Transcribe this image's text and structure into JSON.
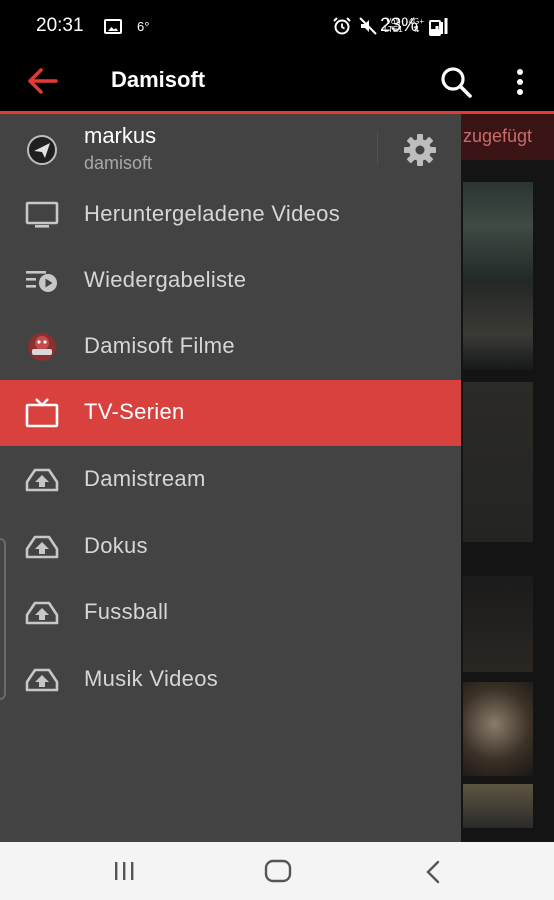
{
  "status_bar": {
    "time": "20:31",
    "temperature": "6°",
    "network_top": "Vo))",
    "network_bottom": "LTE1",
    "network_4g": "4G+",
    "battery": "23%"
  },
  "app_bar": {
    "title": "Damisoft",
    "accent_color": "#e53935"
  },
  "background": {
    "chip_text": "zugefügt"
  },
  "drawer": {
    "account": {
      "name": "markus",
      "subtitle": "damisoft",
      "icon": "send-badge-icon"
    },
    "items": [
      {
        "label": "Heruntergeladene Videos",
        "icon": "downloads-tv-icon",
        "active": false
      },
      {
        "label": "Wiedergabeliste",
        "icon": "playlist-icon",
        "active": false
      },
      {
        "label": "Damisoft Filme",
        "icon": "damisoft-logo-icon",
        "active": false
      },
      {
        "label": "TV-Serien",
        "icon": "tv-icon",
        "active": true
      },
      {
        "label": "Damistream",
        "icon": "cloud-upload-icon",
        "active": false
      },
      {
        "label": "Dokus",
        "icon": "cloud-upload-icon",
        "active": false
      },
      {
        "label": "Fussball",
        "icon": "cloud-upload-icon",
        "active": false
      },
      {
        "label": "Musik Videos",
        "icon": "cloud-upload-icon",
        "active": false
      }
    ],
    "active_color": "#d9413e",
    "background_color": "#434343"
  }
}
